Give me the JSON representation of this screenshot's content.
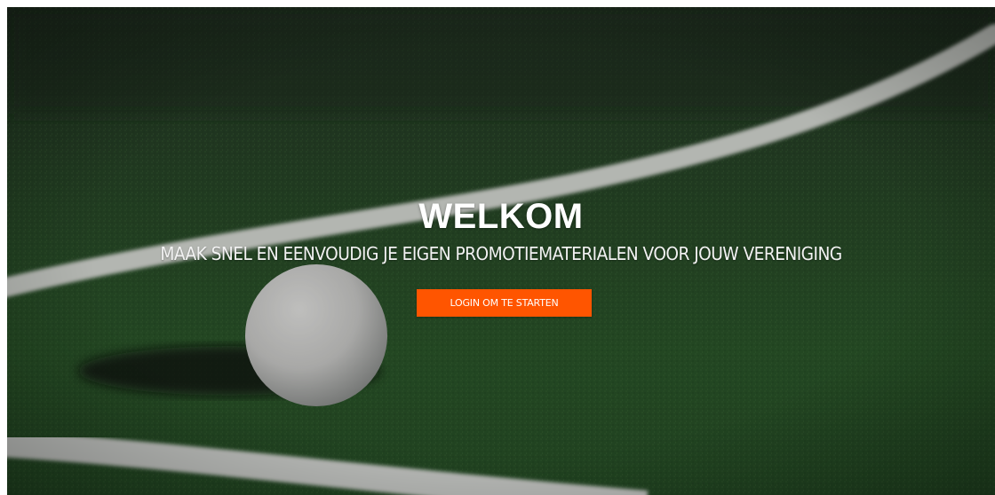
{
  "hero": {
    "title": "WELKOM",
    "subtitle": "MAAK SNEL EN EENVOUDIG JE EIGEN PROMOTIEMATERIALEN VOOR JOUW VERENIGING",
    "cta_label": "LOGIN OM TE STARTEN",
    "background": "hockey-field-photo"
  },
  "colors": {
    "accent": "#ff5500",
    "text": "#ffffff",
    "turf": "#2f5a2e",
    "line": "#e8ebe6"
  }
}
